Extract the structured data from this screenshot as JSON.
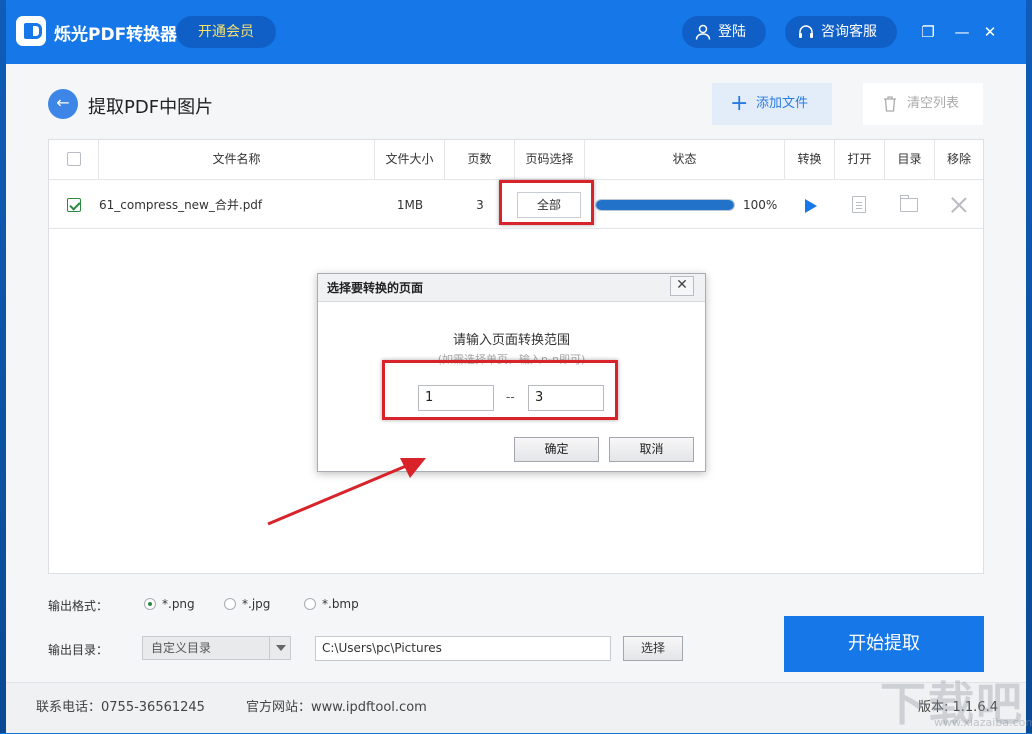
{
  "app": {
    "title": "烁光PDF转换器",
    "vip_label": "开通会员",
    "login_label": "登陆",
    "service_label": "咨询客服",
    "restore_glyph": "❐",
    "minimize_glyph": "—",
    "close_glyph": "✕"
  },
  "page": {
    "back_glyph": "←",
    "title": "提取PDF中图片",
    "add_file_label": "添加文件",
    "clear_list_label": "清空列表"
  },
  "table": {
    "headers": [
      "文件名称",
      "文件大小",
      "页数",
      "页码选择",
      "状态",
      "转换",
      "打开",
      "目录",
      "移除"
    ],
    "rows": [
      {
        "checked": true,
        "name": "61_compress_new_合并.pdf",
        "size": "1MB",
        "pages": "3",
        "page_select": "全部",
        "progress": 1.0,
        "progress_text": "100%"
      }
    ]
  },
  "dialog": {
    "title": "选择要转换的页面",
    "close_glyph": "✕",
    "prompt": "请输入页面转换范围",
    "hint": "(如需选择单页，输入n-n即可)",
    "from": "1",
    "separator": "--",
    "to": "3",
    "ok_label": "确定",
    "cancel_label": "取消"
  },
  "options": {
    "format_label": "输出格式：",
    "formats": [
      {
        "label": "*.png",
        "selected": true
      },
      {
        "label": "*.jpg",
        "selected": false
      },
      {
        "label": "*.bmp",
        "selected": false
      }
    ],
    "dir_label": "输出目录：",
    "dir_mode": "自定义目录",
    "dir_path": "C:\\Users\\pc\\Pictures",
    "choose_label": "选择",
    "start_label": "开始提取"
  },
  "footer": {
    "phone": "联系电话：0755-36561245",
    "website": "官方网站：www.ipdftool.com",
    "version": "版本: 1.1.6.4"
  },
  "watermark": {
    "text": "下载吧",
    "sub": "www.xiazaiba.com"
  },
  "colors": {
    "brand": "#1677e8",
    "highlight_red": "#d8232a",
    "progress": "#2272c9"
  },
  "icons": [
    "app-logo-icon",
    "user-icon",
    "headset-icon",
    "back-arrow-icon",
    "plus-icon",
    "trash-icon",
    "play-icon",
    "document-icon",
    "folder-icon",
    "remove-icon",
    "close-icon",
    "chevron-down-icon"
  ]
}
